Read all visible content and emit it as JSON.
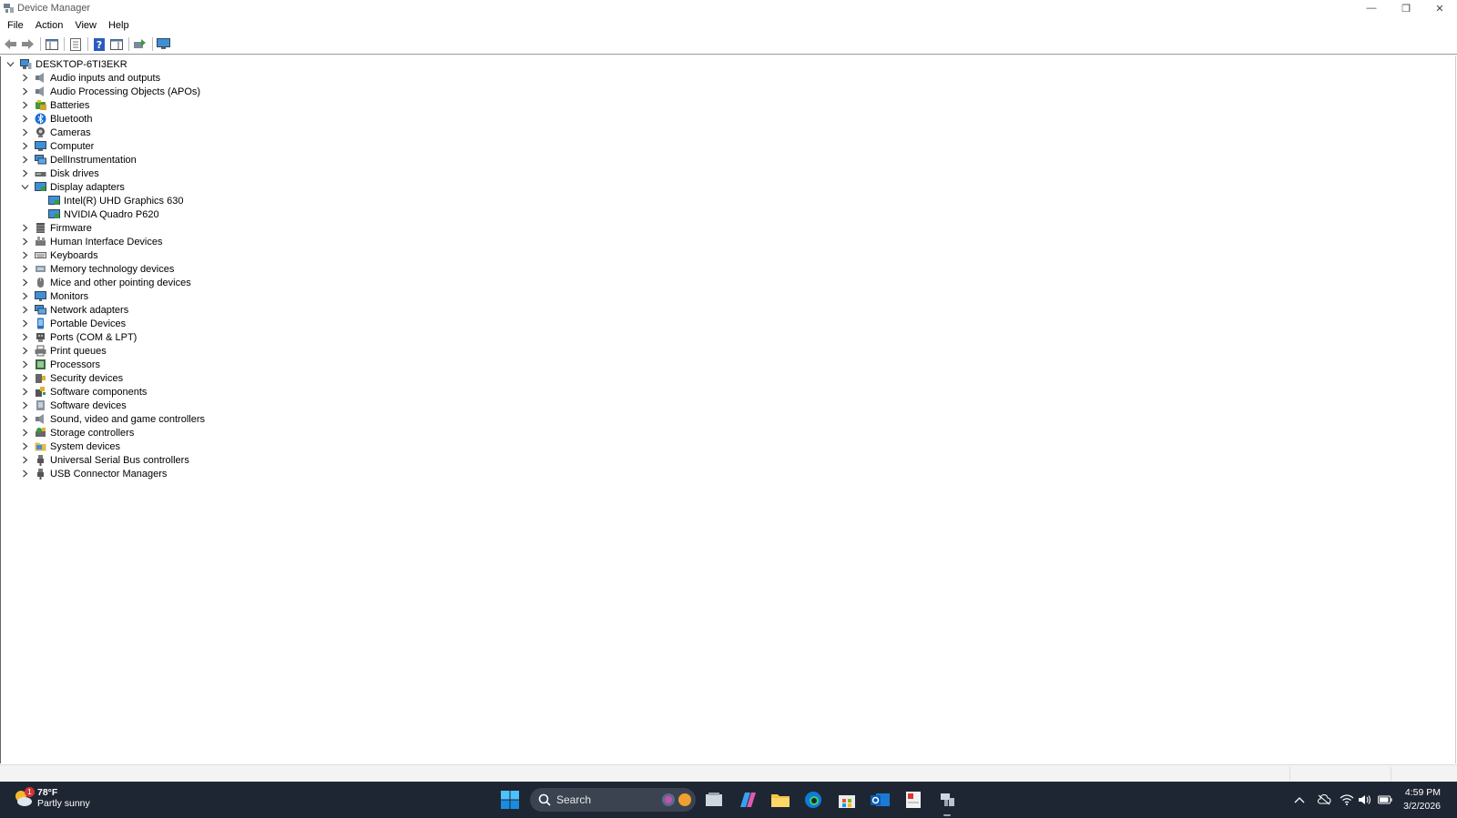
{
  "window": {
    "title": "Device Manager"
  },
  "window_controls": {
    "minimize": "—",
    "restore": "❐",
    "close": "✕"
  },
  "menu": [
    "File",
    "Action",
    "View",
    "Help"
  ],
  "toolbar_icons": [
    "back-icon",
    "forward-icon",
    "show-hide-console-tree-icon",
    "properties-icon",
    "help-icon",
    "action-pane-icon",
    "update-driver-icon",
    "scan-hardware-changes-icon"
  ],
  "tree": {
    "root": "DESKTOP-6TI3EKR",
    "categories": [
      {
        "label": "Audio inputs and outputs",
        "icon": "speaker-icon",
        "expanded": false
      },
      {
        "label": "Audio Processing Objects (APOs)",
        "icon": "speaker-icon",
        "expanded": false
      },
      {
        "label": "Batteries",
        "icon": "battery-icon",
        "expanded": false
      },
      {
        "label": "Bluetooth",
        "icon": "bluetooth-icon",
        "expanded": false
      },
      {
        "label": "Cameras",
        "icon": "camera-icon",
        "expanded": false
      },
      {
        "label": "Computer",
        "icon": "computer-icon",
        "expanded": false
      },
      {
        "label": "DellInstrumentation",
        "icon": "network-icon",
        "expanded": false
      },
      {
        "label": "Disk drives",
        "icon": "disk-icon",
        "expanded": false
      },
      {
        "label": "Display adapters",
        "icon": "display-adapter-icon",
        "expanded": true,
        "children": [
          "Intel(R) UHD Graphics 630",
          "NVIDIA Quadro P620"
        ]
      },
      {
        "label": "Firmware",
        "icon": "firmware-icon",
        "expanded": false
      },
      {
        "label": "Human Interface Devices",
        "icon": "hid-icon",
        "expanded": false
      },
      {
        "label": "Keyboards",
        "icon": "keyboard-icon",
        "expanded": false
      },
      {
        "label": "Memory technology devices",
        "icon": "memory-icon",
        "expanded": false
      },
      {
        "label": "Mice and other pointing devices",
        "icon": "mouse-icon",
        "expanded": false
      },
      {
        "label": "Monitors",
        "icon": "monitor-icon",
        "expanded": false
      },
      {
        "label": "Network adapters",
        "icon": "network-icon",
        "expanded": false
      },
      {
        "label": "Portable Devices",
        "icon": "portable-device-icon",
        "expanded": false
      },
      {
        "label": "Ports (COM & LPT)",
        "icon": "port-icon",
        "expanded": false
      },
      {
        "label": "Print queues",
        "icon": "printer-icon",
        "expanded": false
      },
      {
        "label": "Processors",
        "icon": "processor-icon",
        "expanded": false
      },
      {
        "label": "Security devices",
        "icon": "security-icon",
        "expanded": false
      },
      {
        "label": "Software components",
        "icon": "software-component-icon",
        "expanded": false
      },
      {
        "label": "Software devices",
        "icon": "software-device-icon",
        "expanded": false
      },
      {
        "label": "Sound, video and game controllers",
        "icon": "speaker-icon",
        "expanded": false
      },
      {
        "label": "Storage controllers",
        "icon": "storage-icon",
        "expanded": false
      },
      {
        "label": "System devices",
        "icon": "system-folder-icon",
        "expanded": false
      },
      {
        "label": "Universal Serial Bus controllers",
        "icon": "usb-icon",
        "expanded": false
      },
      {
        "label": "USB Connector Managers",
        "icon": "usb-icon",
        "expanded": false
      }
    ]
  },
  "taskbar": {
    "weather": {
      "temp": "78°F",
      "condition": "Partly sunny",
      "badge": "1"
    },
    "search_label": "Search",
    "apps": [
      "start-icon",
      "task-view-icon",
      "copilot-icon",
      "file-explorer-icon",
      "edge-icon",
      "store-icon",
      "outlook-icon",
      "snipping-tool-icon",
      "device-manager-icon"
    ],
    "tray": [
      "chevron-up-icon",
      "cloud-off-icon",
      "wifi-icon",
      "volume-icon",
      "battery-icon"
    ],
    "time": "4:59 PM",
    "date": "3/2/2026"
  },
  "colors": {
    "taskbar_bg": "#1f2633",
    "accent": "#0078d4",
    "folder": "#e6b949"
  }
}
